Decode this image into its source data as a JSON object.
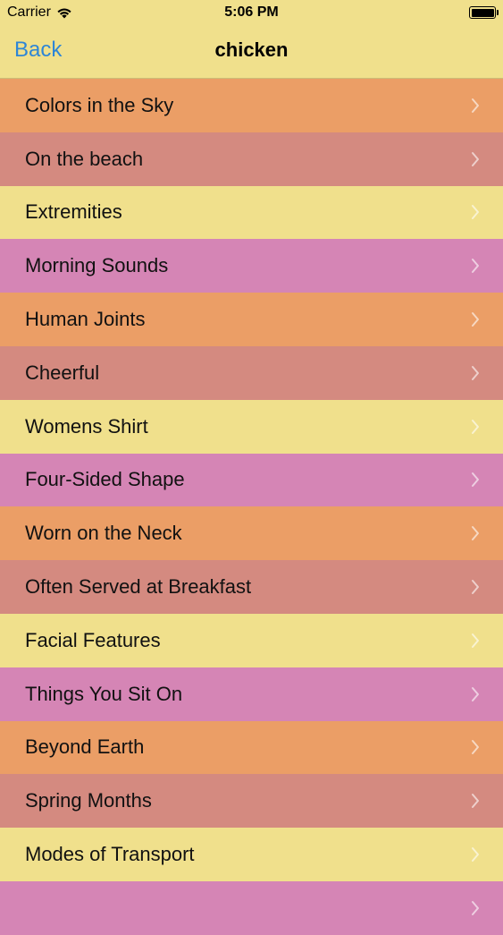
{
  "status_bar": {
    "carrier": "Carrier",
    "time": "5:06 PM"
  },
  "nav": {
    "back_label": "Back",
    "title": "chicken"
  },
  "colors": {
    "orange": "#eb9e66",
    "rose": "#d48a80",
    "yellow": "#f0e08c",
    "pink": "#d585b5",
    "back_blue": "#2e86d6"
  },
  "list": {
    "items": [
      {
        "label": "Colors in the Sky",
        "color": "#eb9e66"
      },
      {
        "label": "On the beach",
        "color": "#d48a80"
      },
      {
        "label": "Extremities",
        "color": "#f0e08c"
      },
      {
        "label": "Morning Sounds",
        "color": "#d585b5"
      },
      {
        "label": "Human Joints",
        "color": "#eb9e66"
      },
      {
        "label": "Cheerful",
        "color": "#d48a80"
      },
      {
        "label": "Womens Shirt",
        "color": "#f0e08c"
      },
      {
        "label": "Four-Sided Shape",
        "color": "#d585b5"
      },
      {
        "label": "Worn on the Neck",
        "color": "#eb9e66"
      },
      {
        "label": "Often Served at Breakfast",
        "color": "#d48a80"
      },
      {
        "label": "Facial Features",
        "color": "#f0e08c"
      },
      {
        "label": "Things You Sit On",
        "color": "#d585b5"
      },
      {
        "label": "Beyond Earth",
        "color": "#eb9e66"
      },
      {
        "label": "Spring Months",
        "color": "#d48a80"
      },
      {
        "label": "Modes of Transport",
        "color": "#f0e08c"
      },
      {
        "label": "",
        "color": "#d585b5"
      }
    ]
  }
}
